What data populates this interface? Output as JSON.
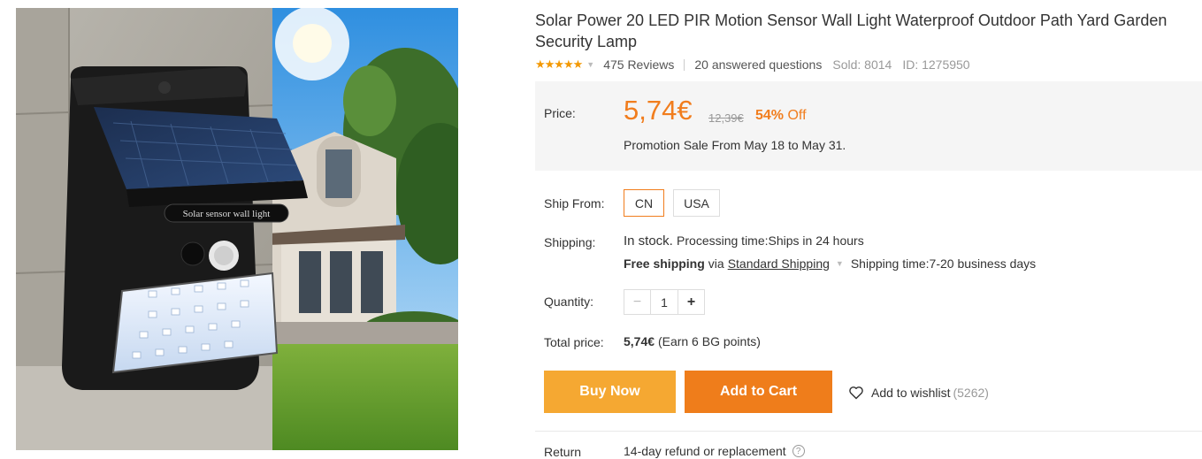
{
  "product": {
    "title": "Solar Power 20 LED PIR Motion Sensor Wall Light Waterproof Outdoor Path Yard Garden Security Lamp",
    "image_label": "Solar sensor wall light",
    "rating_stars": "★★★★★",
    "reviews": "475 Reviews",
    "answered": "20 answered questions",
    "sold": "Sold: 8014",
    "id": "ID: 1275950"
  },
  "price": {
    "label": "Price:",
    "current": "5,74€",
    "original": "12,39€",
    "discount_pct": "54%",
    "discount_word": "Off",
    "promotion": "Promotion Sale From May 18 to May 31."
  },
  "ship_from": {
    "label": "Ship From:",
    "options": [
      "CN",
      "USA"
    ],
    "selected": "CN"
  },
  "shipping": {
    "label": "Shipping:",
    "stock": "In stock.",
    "processing": "Processing time:Ships in 24 hours",
    "free": "Free shipping",
    "via": "via",
    "method": "Standard Shipping",
    "time": "Shipping time:7-20 business days"
  },
  "quantity": {
    "label": "Quantity:",
    "minus": "−",
    "value": "1",
    "plus": "+"
  },
  "total": {
    "label": "Total price:",
    "amount": "5,74€",
    "points": "(Earn 6 BG points)"
  },
  "actions": {
    "buy_now": "Buy Now",
    "add_to_cart": "Add to Cart",
    "wishlist": "Add to wishlist",
    "wishlist_count": "(5262)"
  },
  "return": {
    "label": "Return",
    "value": "14-day refund or replacement",
    "help": "?"
  },
  "colors": {
    "accent": "#f17d1d",
    "buy_now": "#f5a832",
    "add_to_cart": "#ef7d1b",
    "price_box_bg": "#f5f5f5",
    "star": "#f39800"
  }
}
